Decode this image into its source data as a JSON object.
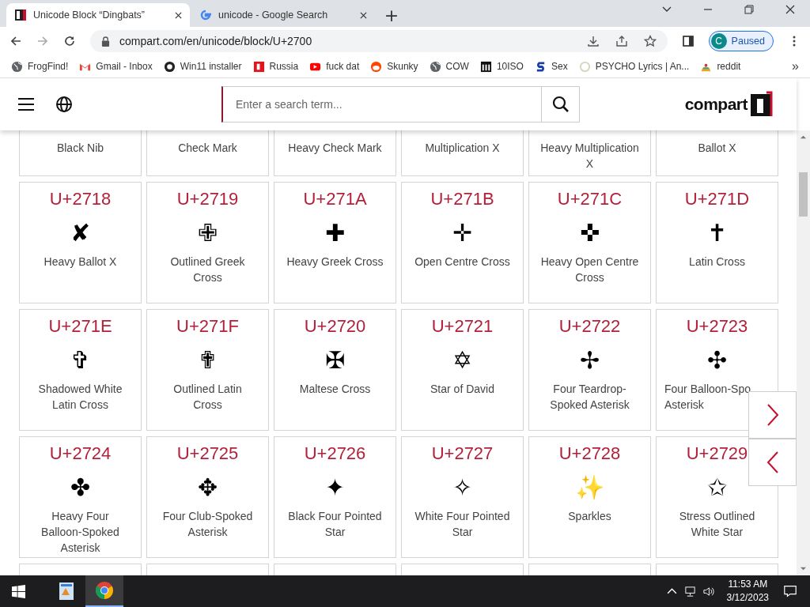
{
  "browser": {
    "tabs": [
      {
        "title": "Unicode Block “Dingbats”",
        "selected": true
      },
      {
        "title": "unicode - Google Search",
        "selected": false
      }
    ],
    "new_tab": "+",
    "url": "compart.com/en/unicode/block/U+2700",
    "profile": {
      "initial": "C",
      "status": "Paused"
    },
    "bookmarks": [
      {
        "label": "FrogFind!",
        "kind": "globe"
      },
      {
        "label": "Gmail - Inbox",
        "kind": "gmail"
      },
      {
        "label": "Win11 installer",
        "kind": "github"
      },
      {
        "label": "Russia",
        "kind": "redsquare"
      },
      {
        "label": "fuck dat",
        "kind": "youtube"
      },
      {
        "label": "Skunky",
        "kind": "reddit"
      },
      {
        "label": "COW",
        "kind": "globe"
      },
      {
        "label": "10ISO",
        "kind": "building"
      },
      {
        "label": "Sex",
        "kind": "letter"
      },
      {
        "label": "PSYCHO Lyrics | An...",
        "kind": "ring"
      },
      {
        "label": "reddit",
        "kind": "hat"
      }
    ],
    "bookmarks_more": "»"
  },
  "header": {
    "search_placeholder": "Enter a search term...",
    "logo": "compart"
  },
  "characters": [
    {
      "kind": "partial",
      "name": "Black Nib"
    },
    {
      "kind": "partial",
      "name": "Check Mark"
    },
    {
      "kind": "partial",
      "name": "Heavy Check Mark"
    },
    {
      "kind": "partial",
      "name": "Multiplication X"
    },
    {
      "kind": "partial",
      "name": "Heavy Multiplication X"
    },
    {
      "kind": "partial",
      "name": "Ballot X"
    },
    {
      "kind": "full",
      "code": "U+2718",
      "glyph": "✘",
      "name": "Heavy Ballot X"
    },
    {
      "kind": "full",
      "code": "U+2719",
      "glyph": "✙",
      "name": "Outlined Greek Cross"
    },
    {
      "kind": "full",
      "code": "U+271A",
      "glyph": "✚",
      "name": "Heavy Greek Cross"
    },
    {
      "kind": "full",
      "code": "U+271B",
      "glyph": "✛",
      "name": "Open Centre Cross"
    },
    {
      "kind": "full",
      "code": "U+271C",
      "glyph": "✜",
      "name": "Heavy Open Centre Cross"
    },
    {
      "kind": "full",
      "code": "U+271D",
      "glyph": "✝",
      "name": "Latin Cross"
    },
    {
      "kind": "full",
      "code": "U+271E",
      "glyph": "✞",
      "name": "Shadowed White Latin Cross"
    },
    {
      "kind": "full",
      "code": "U+271F",
      "glyph": "✟",
      "name": "Outlined Latin Cross"
    },
    {
      "kind": "full",
      "code": "U+2720",
      "glyph": "✠",
      "name": "Maltese Cross"
    },
    {
      "kind": "full",
      "code": "U+2721",
      "glyph": "✡",
      "name": "Star of David"
    },
    {
      "kind": "full",
      "code": "U+2722",
      "glyph": "✢",
      "name": "Four Teardrop-Spoked Asterisk"
    },
    {
      "kind": "full",
      "code": "U+2723",
      "glyph": "✣",
      "name": "Four Balloon-Spo Asterisk"
    },
    {
      "kind": "full",
      "code": "U+2724",
      "glyph": "✤",
      "name": "Heavy Four Balloon-Spoked Asterisk"
    },
    {
      "kind": "full",
      "code": "U+2725",
      "glyph": "✥",
      "name": "Four Club-Spoked Asterisk"
    },
    {
      "kind": "full",
      "code": "U+2726",
      "glyph": "✦",
      "name": "Black Four Pointed Star"
    },
    {
      "kind": "full",
      "code": "U+2727",
      "glyph": "✧",
      "name": "White Four Pointed Star"
    },
    {
      "kind": "full",
      "code": "U+2728",
      "glyph": "✨",
      "name": "Sparkles"
    },
    {
      "kind": "full",
      "code": "U+2729",
      "glyph": "✩",
      "name": "Stress Outlined White Star"
    }
  ],
  "taskbar": {
    "apps": [
      {
        "kind": "files",
        "selected": false
      },
      {
        "kind": "chrome",
        "selected": true
      }
    ],
    "time": "11:53 AM",
    "date": "3/12/2023"
  }
}
